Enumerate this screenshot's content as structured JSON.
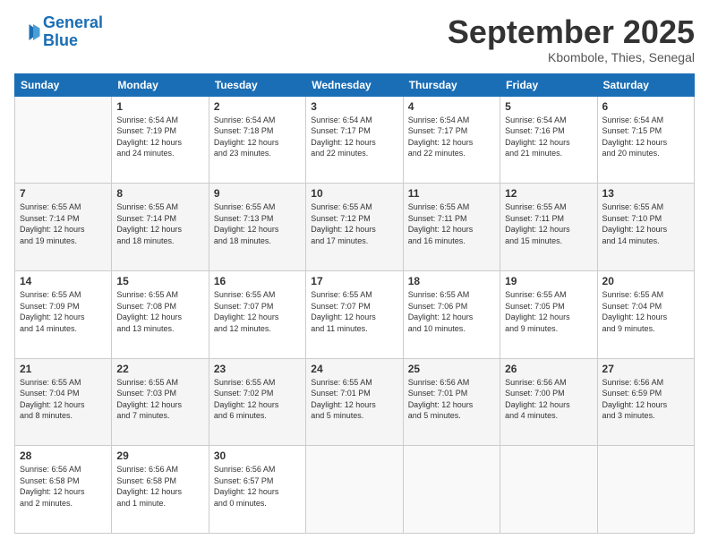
{
  "header": {
    "logo_line1": "General",
    "logo_line2": "Blue",
    "month": "September 2025",
    "location": "Kbombole, Thies, Senegal"
  },
  "days_of_week": [
    "Sunday",
    "Monday",
    "Tuesday",
    "Wednesday",
    "Thursday",
    "Friday",
    "Saturday"
  ],
  "weeks": [
    [
      {
        "day": "",
        "info": ""
      },
      {
        "day": "1",
        "info": "Sunrise: 6:54 AM\nSunset: 7:19 PM\nDaylight: 12 hours\nand 24 minutes."
      },
      {
        "day": "2",
        "info": "Sunrise: 6:54 AM\nSunset: 7:18 PM\nDaylight: 12 hours\nand 23 minutes."
      },
      {
        "day": "3",
        "info": "Sunrise: 6:54 AM\nSunset: 7:17 PM\nDaylight: 12 hours\nand 22 minutes."
      },
      {
        "day": "4",
        "info": "Sunrise: 6:54 AM\nSunset: 7:17 PM\nDaylight: 12 hours\nand 22 minutes."
      },
      {
        "day": "5",
        "info": "Sunrise: 6:54 AM\nSunset: 7:16 PM\nDaylight: 12 hours\nand 21 minutes."
      },
      {
        "day": "6",
        "info": "Sunrise: 6:54 AM\nSunset: 7:15 PM\nDaylight: 12 hours\nand 20 minutes."
      }
    ],
    [
      {
        "day": "7",
        "info": "Sunrise: 6:55 AM\nSunset: 7:14 PM\nDaylight: 12 hours\nand 19 minutes."
      },
      {
        "day": "8",
        "info": "Sunrise: 6:55 AM\nSunset: 7:14 PM\nDaylight: 12 hours\nand 18 minutes."
      },
      {
        "day": "9",
        "info": "Sunrise: 6:55 AM\nSunset: 7:13 PM\nDaylight: 12 hours\nand 18 minutes."
      },
      {
        "day": "10",
        "info": "Sunrise: 6:55 AM\nSunset: 7:12 PM\nDaylight: 12 hours\nand 17 minutes."
      },
      {
        "day": "11",
        "info": "Sunrise: 6:55 AM\nSunset: 7:11 PM\nDaylight: 12 hours\nand 16 minutes."
      },
      {
        "day": "12",
        "info": "Sunrise: 6:55 AM\nSunset: 7:11 PM\nDaylight: 12 hours\nand 15 minutes."
      },
      {
        "day": "13",
        "info": "Sunrise: 6:55 AM\nSunset: 7:10 PM\nDaylight: 12 hours\nand 14 minutes."
      }
    ],
    [
      {
        "day": "14",
        "info": "Sunrise: 6:55 AM\nSunset: 7:09 PM\nDaylight: 12 hours\nand 14 minutes."
      },
      {
        "day": "15",
        "info": "Sunrise: 6:55 AM\nSunset: 7:08 PM\nDaylight: 12 hours\nand 13 minutes."
      },
      {
        "day": "16",
        "info": "Sunrise: 6:55 AM\nSunset: 7:07 PM\nDaylight: 12 hours\nand 12 minutes."
      },
      {
        "day": "17",
        "info": "Sunrise: 6:55 AM\nSunset: 7:07 PM\nDaylight: 12 hours\nand 11 minutes."
      },
      {
        "day": "18",
        "info": "Sunrise: 6:55 AM\nSunset: 7:06 PM\nDaylight: 12 hours\nand 10 minutes."
      },
      {
        "day": "19",
        "info": "Sunrise: 6:55 AM\nSunset: 7:05 PM\nDaylight: 12 hours\nand 9 minutes."
      },
      {
        "day": "20",
        "info": "Sunrise: 6:55 AM\nSunset: 7:04 PM\nDaylight: 12 hours\nand 9 minutes."
      }
    ],
    [
      {
        "day": "21",
        "info": "Sunrise: 6:55 AM\nSunset: 7:04 PM\nDaylight: 12 hours\nand 8 minutes."
      },
      {
        "day": "22",
        "info": "Sunrise: 6:55 AM\nSunset: 7:03 PM\nDaylight: 12 hours\nand 7 minutes."
      },
      {
        "day": "23",
        "info": "Sunrise: 6:55 AM\nSunset: 7:02 PM\nDaylight: 12 hours\nand 6 minutes."
      },
      {
        "day": "24",
        "info": "Sunrise: 6:55 AM\nSunset: 7:01 PM\nDaylight: 12 hours\nand 5 minutes."
      },
      {
        "day": "25",
        "info": "Sunrise: 6:56 AM\nSunset: 7:01 PM\nDaylight: 12 hours\nand 5 minutes."
      },
      {
        "day": "26",
        "info": "Sunrise: 6:56 AM\nSunset: 7:00 PM\nDaylight: 12 hours\nand 4 minutes."
      },
      {
        "day": "27",
        "info": "Sunrise: 6:56 AM\nSunset: 6:59 PM\nDaylight: 12 hours\nand 3 minutes."
      }
    ],
    [
      {
        "day": "28",
        "info": "Sunrise: 6:56 AM\nSunset: 6:58 PM\nDaylight: 12 hours\nand 2 minutes."
      },
      {
        "day": "29",
        "info": "Sunrise: 6:56 AM\nSunset: 6:58 PM\nDaylight: 12 hours\nand 1 minute."
      },
      {
        "day": "30",
        "info": "Sunrise: 6:56 AM\nSunset: 6:57 PM\nDaylight: 12 hours\nand 0 minutes."
      },
      {
        "day": "",
        "info": ""
      },
      {
        "day": "",
        "info": ""
      },
      {
        "day": "",
        "info": ""
      },
      {
        "day": "",
        "info": ""
      }
    ]
  ]
}
